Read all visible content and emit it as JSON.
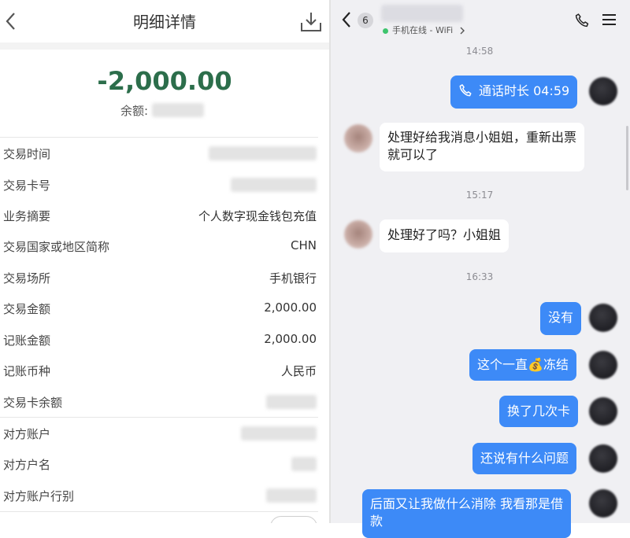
{
  "left": {
    "title": "明细详情",
    "amount": "-2,000.00",
    "balance_label": "余额:",
    "rows": [
      {
        "label": "交易时间",
        "value": ""
      },
      {
        "label": "交易卡号",
        "value": ""
      },
      {
        "label": "业务摘要",
        "value": "个人数字现金钱包充值"
      },
      {
        "label": "交易国家或地区简称",
        "value": "CHN"
      },
      {
        "label": "交易场所",
        "value": "手机银行"
      },
      {
        "label": "交易金额",
        "value": "2,000.00"
      },
      {
        "label": "记账金额",
        "value": "2,000.00"
      },
      {
        "label": "记账币种",
        "value": "人民币"
      },
      {
        "label": "交易卡余额",
        "value": ""
      },
      {
        "label": "对方账户",
        "value": ""
      },
      {
        "label": "对方户名",
        "value": ""
      },
      {
        "label": "对方账户行别",
        "value": ""
      }
    ],
    "icons": {
      "back": "chevron-left-icon",
      "download": "download-icon"
    },
    "colors": {
      "amount": "#2c6e4b"
    }
  },
  "right": {
    "unread_count": "6",
    "status": "手机在线 - WiFi",
    "icons": {
      "back": "chevron-left-icon",
      "status_arrow": "chevron-right-icon",
      "call": "phone-icon",
      "menu": "menu-icon"
    },
    "times": [
      "14:58",
      "15:17",
      "16:33"
    ],
    "messages": [
      {
        "from": "self",
        "text": "通话时长 04:59",
        "icon": "phone-icon"
      },
      {
        "from": "other",
        "line1": "处理好给我消息小姐姐，重新出票",
        "line2": "就可以了"
      },
      {
        "from": "other",
        "text": "处理好了吗？小姐姐"
      },
      {
        "from": "self",
        "text": "没有"
      },
      {
        "from": "self",
        "before": "这个一直",
        "emoji": "💰",
        "after": "冻结"
      },
      {
        "from": "self",
        "text": "换了几次卡"
      },
      {
        "from": "self",
        "text": "还说有什么问题"
      },
      {
        "from": "self",
        "line1": "后面又让我做什么消除 我看那是借",
        "line2": "款"
      }
    ],
    "colors": {
      "self_bubble": "#3d8af7",
      "other_bubble": "#ffffff",
      "online_dot": "#3ec46d"
    }
  }
}
